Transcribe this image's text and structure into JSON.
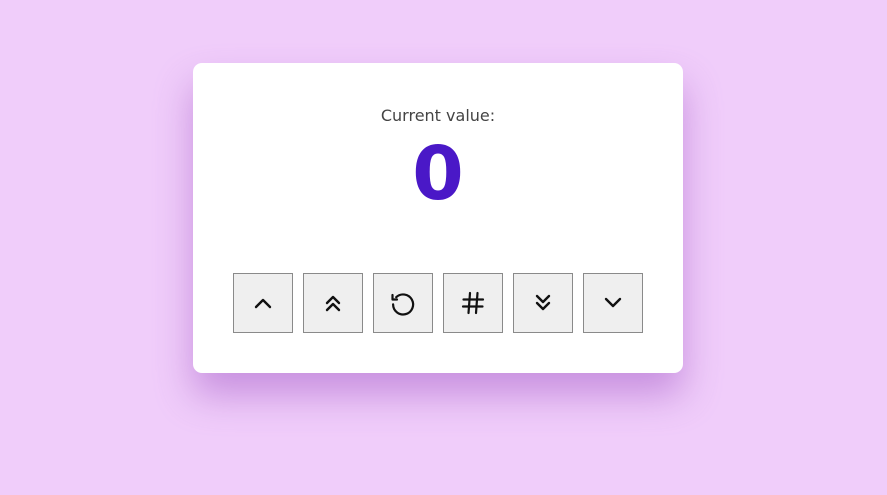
{
  "counter": {
    "label": "Current value:",
    "value": "0"
  },
  "buttons": [
    {
      "icon": "chevron-up-icon"
    },
    {
      "icon": "double-chevron-up-icon"
    },
    {
      "icon": "reset-icon"
    },
    {
      "icon": "hash-icon"
    },
    {
      "icon": "double-chevron-down-icon"
    },
    {
      "icon": "chevron-down-icon"
    }
  ],
  "colors": {
    "background": "#f0cdfa",
    "card": "#ffffff",
    "value": "#4a18c7",
    "label": "#444444",
    "button": "#efefef"
  }
}
